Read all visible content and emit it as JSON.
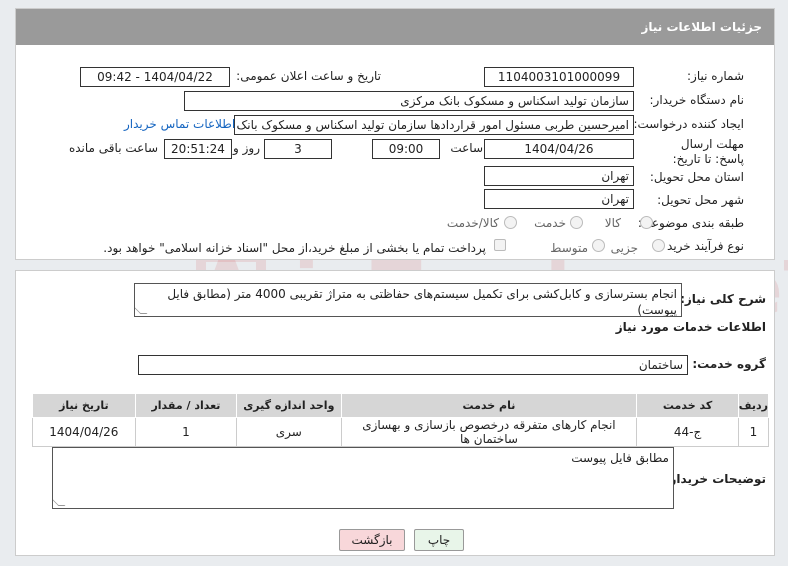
{
  "header": {
    "title": "جزئیات اطلاعات نیاز"
  },
  "fields": {
    "need_number_label": "شماره نیاز:",
    "need_number": "1104003101000099",
    "announce_label": "تاریخ و ساعت اعلان عمومی:",
    "announce_value": "1404/04/22 - 09:42",
    "buyer_org_label": "نام دستگاه خریدار:",
    "buyer_org": "سازمان تولید اسکناس و مسکوک بانک مرکزی",
    "requester_label": "ایجاد کننده درخواست:",
    "requester": "امیرحسین طربی مسئول امور قراردادها سازمان تولید اسکناس و مسکوک بانک مرکزی",
    "contact_link": "اطلاعات تماس خریدار",
    "deadline_label": "مهلت ارسال پاسخ: تا تاریخ:",
    "deadline_date": "1404/04/26",
    "time_label": "ساعت",
    "deadline_time": "09:00",
    "days_value": "3",
    "days_label": "روز و",
    "remaining_time": "20:51:24",
    "remaining_label": "ساعت باقی مانده",
    "province_label": "استان محل تحویل:",
    "province": "تهران",
    "city_label": "شهر محل تحویل:",
    "city": "تهران",
    "category_label": "طبقه بندی موضوعی:",
    "category_options": [
      "کالا",
      "خدمت",
      "کالا/خدمت"
    ],
    "process_label": "نوع فرآیند خرید :",
    "process_options": [
      "جزیی",
      "متوسط"
    ],
    "payment_note": "پرداخت تمام یا بخشی از مبلغ خرید،از محل \"اسناد خزانه اسلامی\" خواهد بود."
  },
  "general_desc": {
    "label": "شرح کلی نیاز:",
    "text": "انجام بسترسازی و کابل‌کشی برای تکمیل سیستم‌های حفاظتی به متراژ تقریبی 4000 متر (مطابق فایل پیوست)"
  },
  "services": {
    "section_title": "اطلاعات خدمات مورد نیاز",
    "group_label": "گروه خدمت:",
    "group_value": "ساختمان",
    "columns": [
      "ردیف",
      "کد خدمت",
      "نام خدمت",
      "واحد اندازه گیری",
      "تعداد / مقدار",
      "تاریخ نیاز"
    ],
    "rows": [
      [
        "1",
        "ج-44",
        "انجام کارهای متفرقه درخصوص بازسازی و بهسازی ساختمان ها",
        "سری",
        "1",
        "1404/04/26"
      ]
    ]
  },
  "buyer_notes": {
    "label": "توضیحات خریدار:",
    "text": "مطابق فایل پیوست"
  },
  "buttons": {
    "print": "چاپ",
    "back": "بازگشت"
  },
  "watermark": "AriaTender.neT",
  "colors": {
    "header_bg": "#9a9a9a",
    "link": "#1565c0",
    "back_btn": "#f8d7da",
    "print_btn": "#e8f5e9"
  }
}
